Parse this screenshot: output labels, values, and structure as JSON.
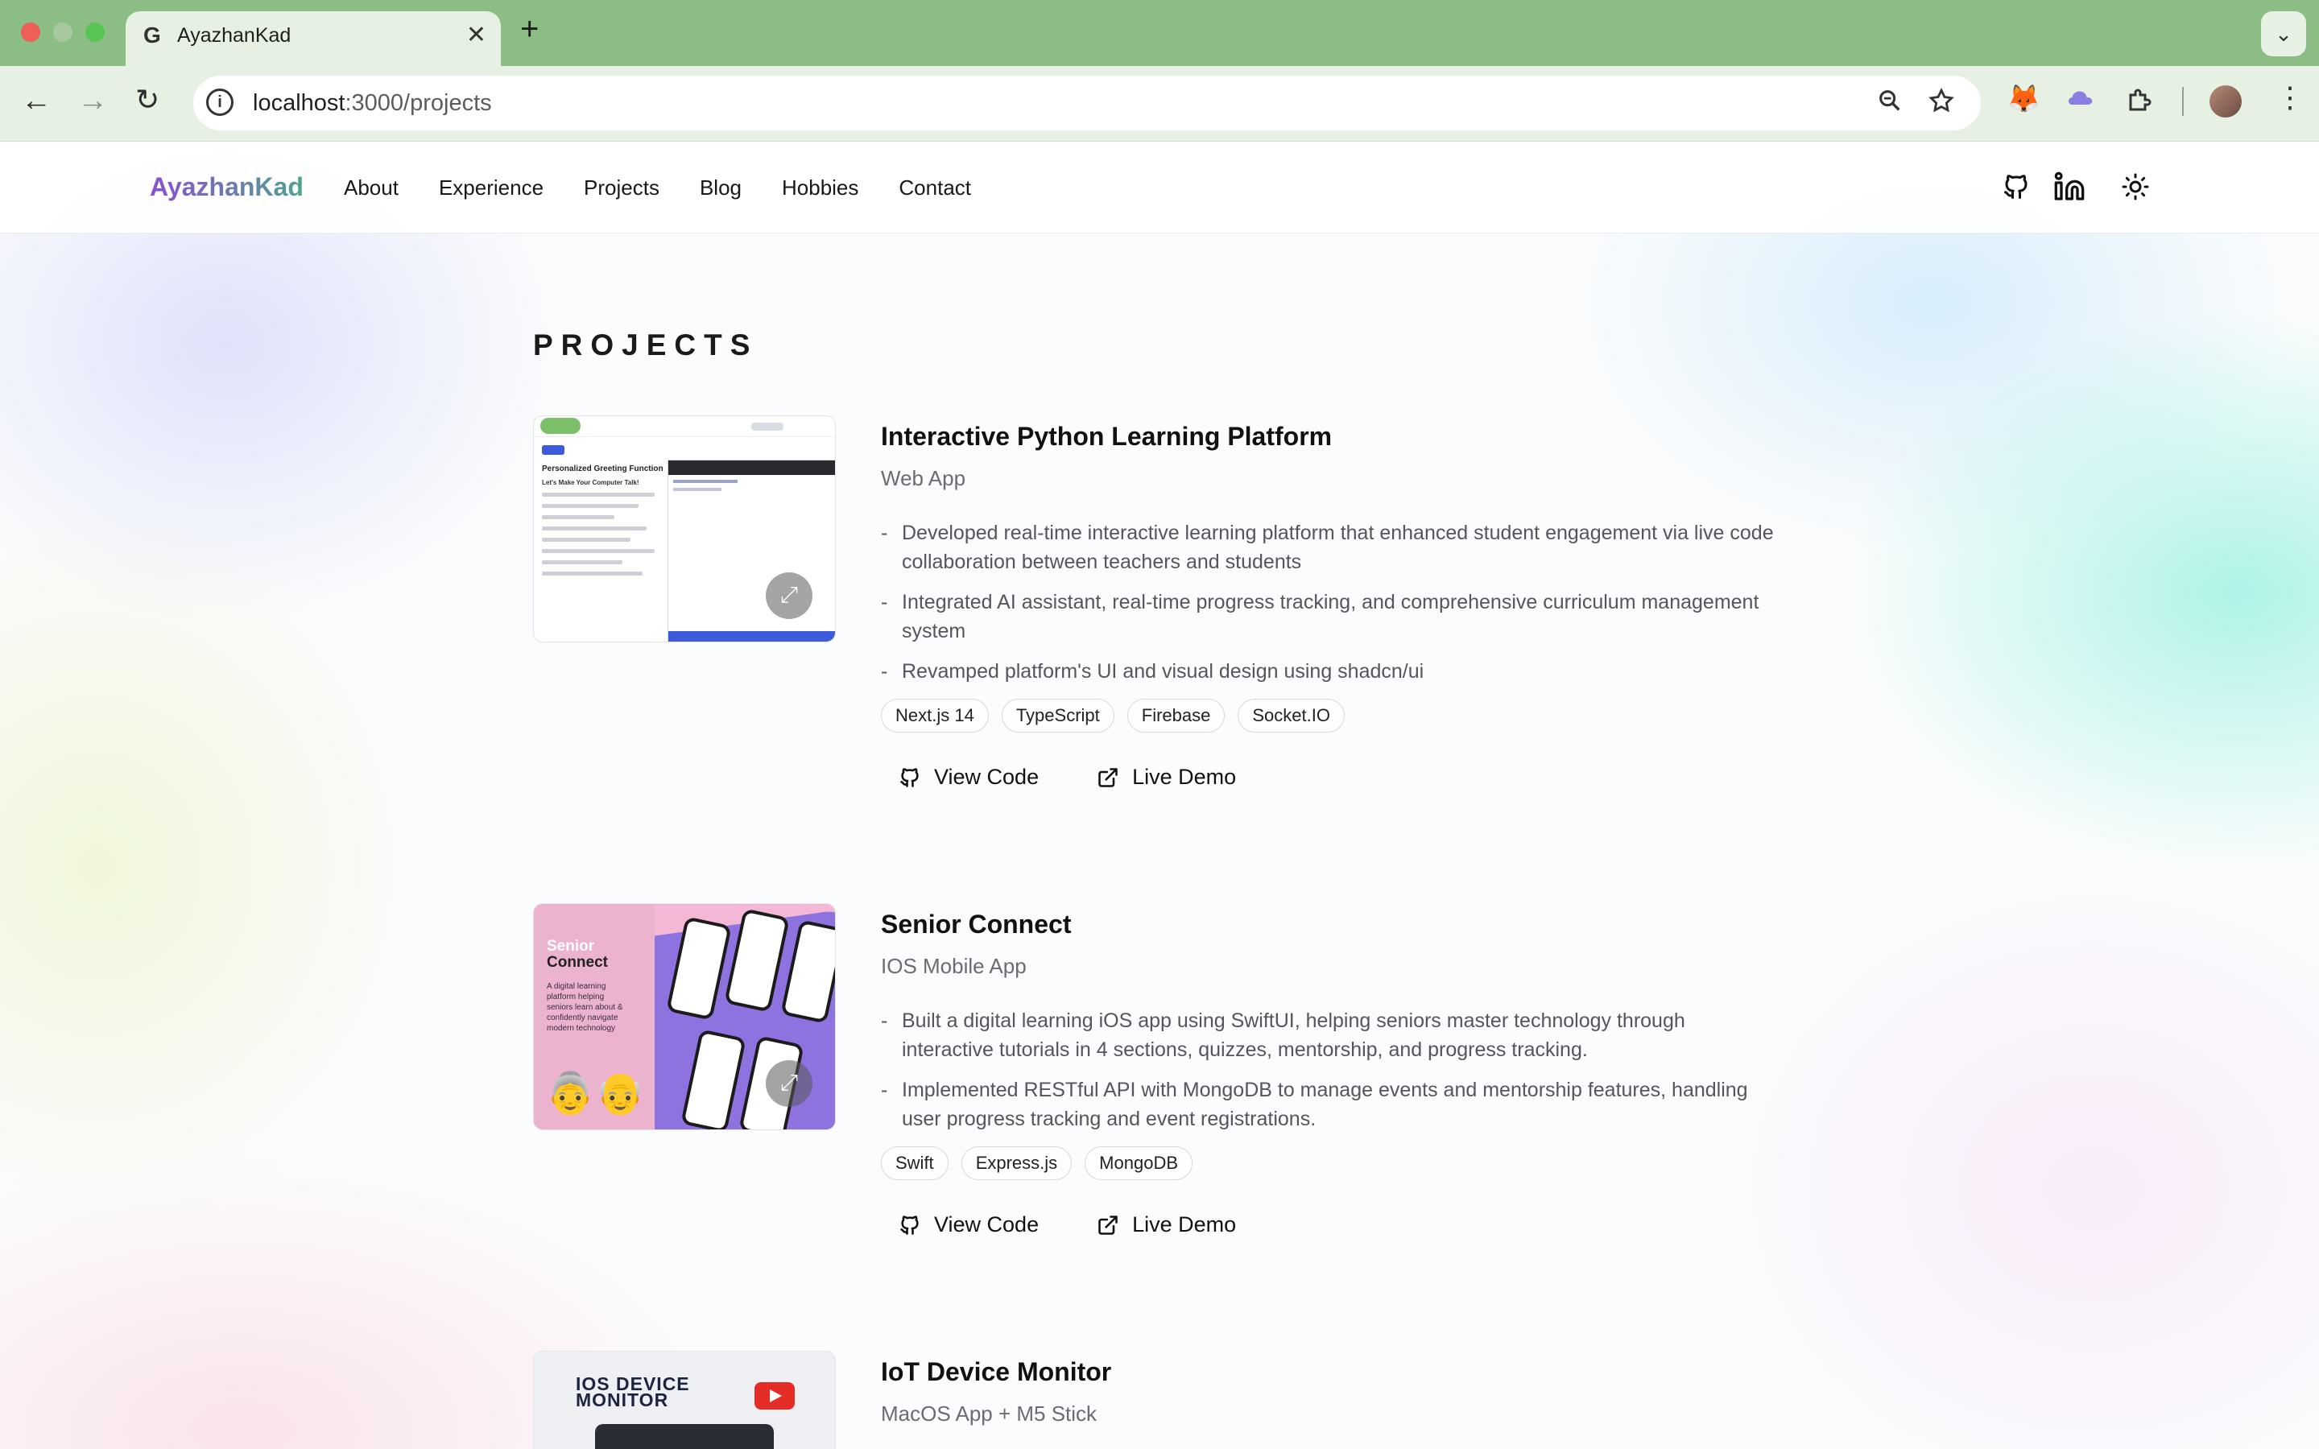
{
  "browser": {
    "tab_title": "AyazhanKad",
    "tab_favicon": "G",
    "url_host": "localhost",
    "url_path": ":3000/projects"
  },
  "site": {
    "logo": "AyazhanKad",
    "nav": [
      "About",
      "Experience",
      "Projects",
      "Blog",
      "Hobbies",
      "Contact"
    ]
  },
  "section_title": "PROJECTS",
  "projects": [
    {
      "title": "Interactive Python Learning Platform",
      "subtitle": "Web App",
      "bullets": [
        "Developed real-time interactive learning platform that enhanced student engagement via live code collaboration between teachers and students",
        "Integrated AI assistant, real-time progress tracking, and comprehensive curriculum management system",
        "Revamped platform's UI and visual design using shadcn/ui"
      ],
      "tags": [
        "Next.js 14",
        "TypeScript",
        "Firebase",
        "Socket.IO"
      ],
      "view_code": "View Code",
      "live_demo": "Live Demo"
    },
    {
      "title": "Senior Connect",
      "subtitle": "IOS Mobile App",
      "bullets": [
        "Built a digital learning iOS app using SwiftUI, helping seniors master technology through interactive tutorials in 4 sections, quizzes, mentorship, and progress tracking.",
        "Implemented RESTful API with MongoDB to manage events and mentorship features, handling user progress tracking and event registrations."
      ],
      "tags": [
        "Swift",
        "Express.js",
        "MongoDB"
      ],
      "view_code": "View Code",
      "live_demo": "Live Demo",
      "thumb_title_1": "Senior",
      "thumb_title_2": "Connect",
      "thumb_text": "A digital learning platform helping seniors learn about & confidently navigate modern technology"
    },
    {
      "title": "IoT Device Monitor",
      "subtitle": "MacOS App + M5 Stick",
      "thumb_title": "IOS DEVICE MONITOR"
    }
  ],
  "thumb1": {
    "heading": "Personalized Greeting Function",
    "sub": "Let's Make Your Computer Talk!"
  }
}
